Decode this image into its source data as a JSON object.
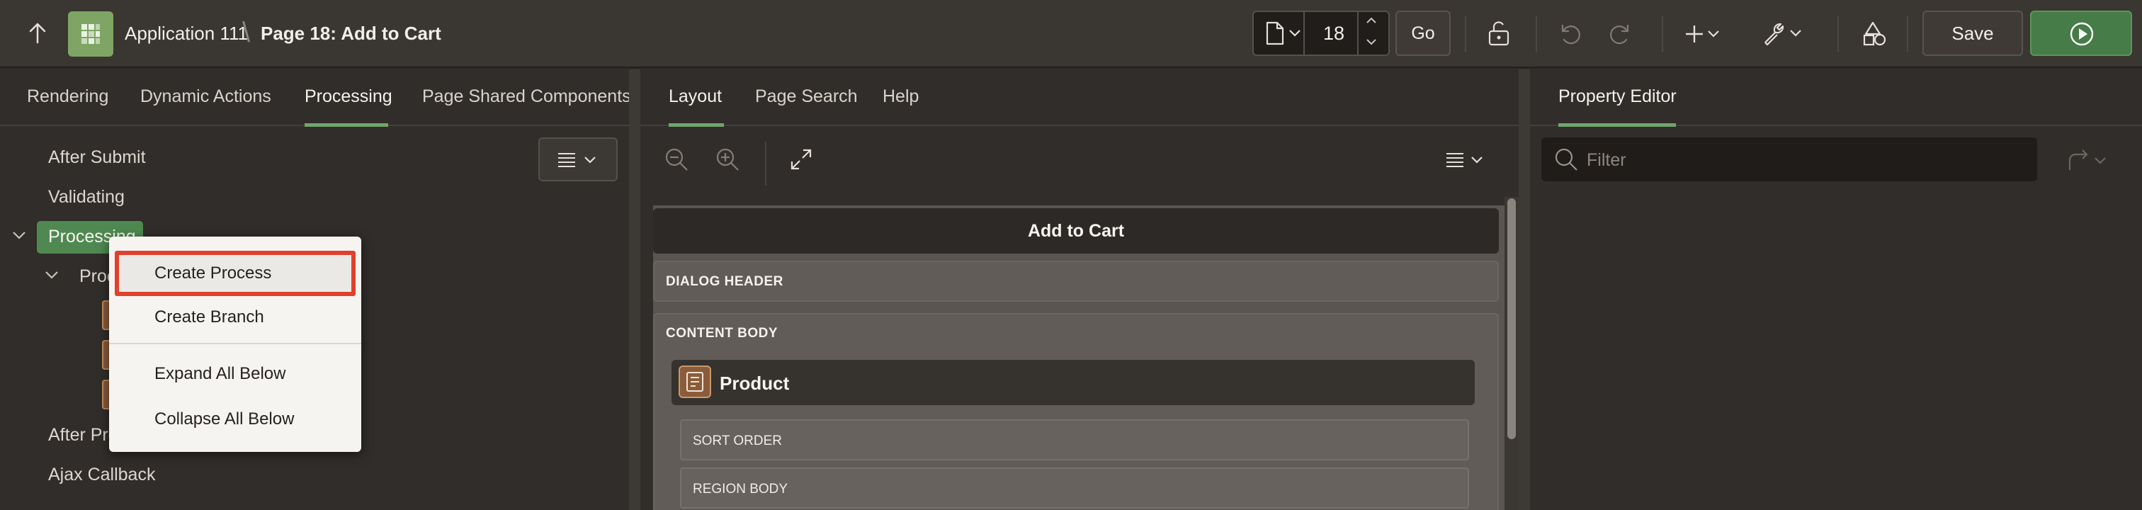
{
  "header": {
    "app_name": "Application 111",
    "breadcrumb_sep": "\\",
    "page_name": "Page 18: Add to Cart",
    "page_number": "18",
    "go_label": "Go",
    "save_label": "Save"
  },
  "left_tabs": [
    {
      "label": "Rendering"
    },
    {
      "label": "Dynamic Actions"
    },
    {
      "label": "Processing"
    },
    {
      "label": "Page Shared Components"
    }
  ],
  "tree": {
    "after_submit": "After Submit",
    "validating": "Validating",
    "processing": "Processing",
    "processes": "Processes",
    "after_processing": "After Processing",
    "ajax_callback": "Ajax Callback"
  },
  "context_menu": {
    "items": [
      {
        "label": "Create Process"
      },
      {
        "label": "Create Branch"
      },
      {
        "label": "Expand All Below"
      },
      {
        "label": "Collapse All Below"
      }
    ]
  },
  "mid_tabs": [
    {
      "label": "Layout"
    },
    {
      "label": "Page Search"
    },
    {
      "label": "Help"
    }
  ],
  "layout": {
    "dialog_title": "Add to Cart",
    "dialog_header": "DIALOG HEADER",
    "content_body": "CONTENT BODY",
    "region_title": "Product",
    "sort_order": "SORT ORDER",
    "region_body": "REGION BODY"
  },
  "right_tabs": [
    {
      "label": "Property Editor"
    }
  ],
  "filter": {
    "placeholder": "Filter"
  },
  "colors": {
    "accent_green": "#6fa66c",
    "run_button": "#467c47",
    "highlight_red": "#e0402c"
  },
  "icons": [
    "up-arrow-icon",
    "app-grid-icon",
    "page-icon",
    "lock-icon",
    "undo-icon",
    "redo-icon",
    "plus-icon",
    "wrench-icon",
    "shapes-icon",
    "run-icon",
    "menu-icon",
    "zoom-out-icon",
    "zoom-in-icon",
    "expand-icon",
    "search-icon",
    "goto-icon"
  ]
}
